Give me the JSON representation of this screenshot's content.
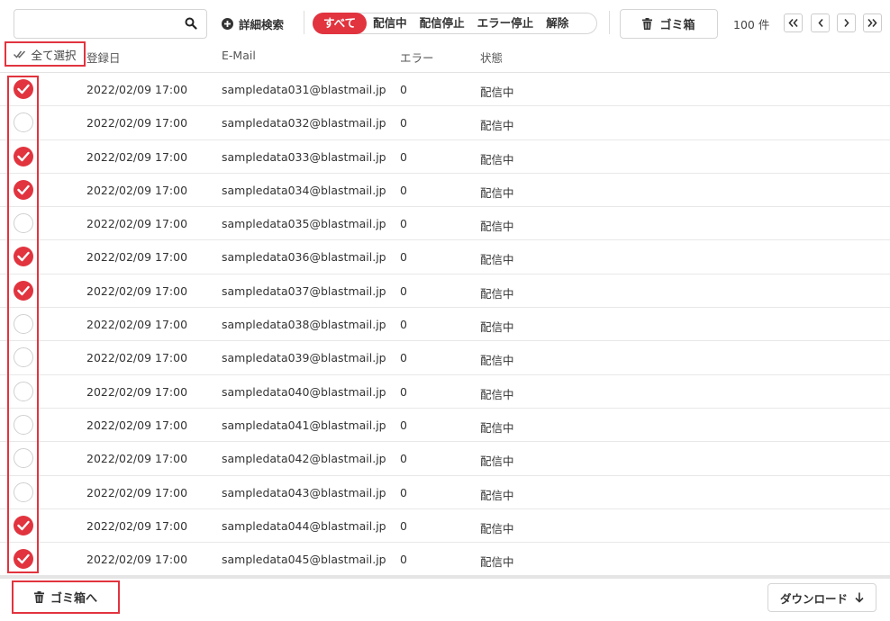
{
  "toolbar": {
    "search_placeholder": "",
    "advanced_search_label": "詳細検索",
    "filters": [
      {
        "label": "すべて",
        "active": true
      },
      {
        "label": "配信中",
        "active": false
      },
      {
        "label": "配信停止",
        "active": false
      },
      {
        "label": "エラー停止",
        "active": false
      },
      {
        "label": "解除",
        "active": false
      }
    ],
    "trash_label": "ゴミ箱",
    "count_label": "100 件"
  },
  "table": {
    "select_all_label": "全て選択",
    "columns": [
      "登録日",
      "E-Mail",
      "エラー",
      "状態"
    ],
    "rows": [
      {
        "checked": true,
        "date": "2022/02/09 17:00",
        "email": "sampledata031@blastmail.jp",
        "error": "0",
        "status": "配信中"
      },
      {
        "checked": false,
        "date": "2022/02/09 17:00",
        "email": "sampledata032@blastmail.jp",
        "error": "0",
        "status": "配信中"
      },
      {
        "checked": true,
        "date": "2022/02/09 17:00",
        "email": "sampledata033@blastmail.jp",
        "error": "0",
        "status": "配信中"
      },
      {
        "checked": true,
        "date": "2022/02/09 17:00",
        "email": "sampledata034@blastmail.jp",
        "error": "0",
        "status": "配信中"
      },
      {
        "checked": false,
        "date": "2022/02/09 17:00",
        "email": "sampledata035@blastmail.jp",
        "error": "0",
        "status": "配信中"
      },
      {
        "checked": true,
        "date": "2022/02/09 17:00",
        "email": "sampledata036@blastmail.jp",
        "error": "0",
        "status": "配信中"
      },
      {
        "checked": true,
        "date": "2022/02/09 17:00",
        "email": "sampledata037@blastmail.jp",
        "error": "0",
        "status": "配信中"
      },
      {
        "checked": false,
        "date": "2022/02/09 17:00",
        "email": "sampledata038@blastmail.jp",
        "error": "0",
        "status": "配信中"
      },
      {
        "checked": false,
        "date": "2022/02/09 17:00",
        "email": "sampledata039@blastmail.jp",
        "error": "0",
        "status": "配信中"
      },
      {
        "checked": false,
        "date": "2022/02/09 17:00",
        "email": "sampledata040@blastmail.jp",
        "error": "0",
        "status": "配信中"
      },
      {
        "checked": false,
        "date": "2022/02/09 17:00",
        "email": "sampledata041@blastmail.jp",
        "error": "0",
        "status": "配信中"
      },
      {
        "checked": false,
        "date": "2022/02/09 17:00",
        "email": "sampledata042@blastmail.jp",
        "error": "0",
        "status": "配信中"
      },
      {
        "checked": false,
        "date": "2022/02/09 17:00",
        "email": "sampledata043@blastmail.jp",
        "error": "0",
        "status": "配信中"
      },
      {
        "checked": true,
        "date": "2022/02/09 17:00",
        "email": "sampledata044@blastmail.jp",
        "error": "0",
        "status": "配信中"
      },
      {
        "checked": true,
        "date": "2022/02/09 17:00",
        "email": "sampledata045@blastmail.jp",
        "error": "0",
        "status": "配信中"
      }
    ]
  },
  "footer": {
    "move_to_trash_label": "ゴミ箱へ",
    "download_label": "ダウンロード"
  },
  "colors": {
    "accent": "#e1343f",
    "border": "#d5d5d5"
  }
}
